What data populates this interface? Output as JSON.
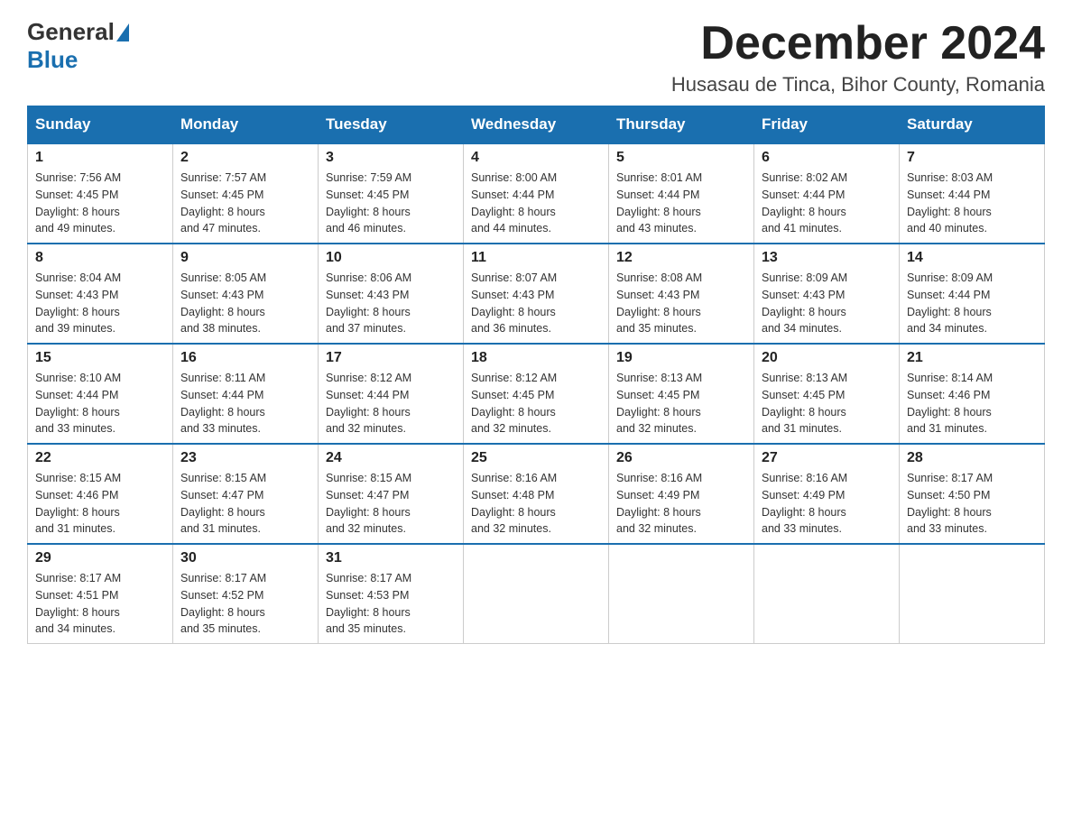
{
  "logo": {
    "general": "General",
    "blue": "Blue"
  },
  "header": {
    "month_title": "December 2024",
    "subtitle": "Husasau de Tinca, Bihor County, Romania"
  },
  "weekdays": [
    "Sunday",
    "Monday",
    "Tuesday",
    "Wednesday",
    "Thursday",
    "Friday",
    "Saturday"
  ],
  "weeks": [
    [
      {
        "day": "1",
        "info": "Sunrise: 7:56 AM\nSunset: 4:45 PM\nDaylight: 8 hours\nand 49 minutes."
      },
      {
        "day": "2",
        "info": "Sunrise: 7:57 AM\nSunset: 4:45 PM\nDaylight: 8 hours\nand 47 minutes."
      },
      {
        "day": "3",
        "info": "Sunrise: 7:59 AM\nSunset: 4:45 PM\nDaylight: 8 hours\nand 46 minutes."
      },
      {
        "day": "4",
        "info": "Sunrise: 8:00 AM\nSunset: 4:44 PM\nDaylight: 8 hours\nand 44 minutes."
      },
      {
        "day": "5",
        "info": "Sunrise: 8:01 AM\nSunset: 4:44 PM\nDaylight: 8 hours\nand 43 minutes."
      },
      {
        "day": "6",
        "info": "Sunrise: 8:02 AM\nSunset: 4:44 PM\nDaylight: 8 hours\nand 41 minutes."
      },
      {
        "day": "7",
        "info": "Sunrise: 8:03 AM\nSunset: 4:44 PM\nDaylight: 8 hours\nand 40 minutes."
      }
    ],
    [
      {
        "day": "8",
        "info": "Sunrise: 8:04 AM\nSunset: 4:43 PM\nDaylight: 8 hours\nand 39 minutes."
      },
      {
        "day": "9",
        "info": "Sunrise: 8:05 AM\nSunset: 4:43 PM\nDaylight: 8 hours\nand 38 minutes."
      },
      {
        "day": "10",
        "info": "Sunrise: 8:06 AM\nSunset: 4:43 PM\nDaylight: 8 hours\nand 37 minutes."
      },
      {
        "day": "11",
        "info": "Sunrise: 8:07 AM\nSunset: 4:43 PM\nDaylight: 8 hours\nand 36 minutes."
      },
      {
        "day": "12",
        "info": "Sunrise: 8:08 AM\nSunset: 4:43 PM\nDaylight: 8 hours\nand 35 minutes."
      },
      {
        "day": "13",
        "info": "Sunrise: 8:09 AM\nSunset: 4:43 PM\nDaylight: 8 hours\nand 34 minutes."
      },
      {
        "day": "14",
        "info": "Sunrise: 8:09 AM\nSunset: 4:44 PM\nDaylight: 8 hours\nand 34 minutes."
      }
    ],
    [
      {
        "day": "15",
        "info": "Sunrise: 8:10 AM\nSunset: 4:44 PM\nDaylight: 8 hours\nand 33 minutes."
      },
      {
        "day": "16",
        "info": "Sunrise: 8:11 AM\nSunset: 4:44 PM\nDaylight: 8 hours\nand 33 minutes."
      },
      {
        "day": "17",
        "info": "Sunrise: 8:12 AM\nSunset: 4:44 PM\nDaylight: 8 hours\nand 32 minutes."
      },
      {
        "day": "18",
        "info": "Sunrise: 8:12 AM\nSunset: 4:45 PM\nDaylight: 8 hours\nand 32 minutes."
      },
      {
        "day": "19",
        "info": "Sunrise: 8:13 AM\nSunset: 4:45 PM\nDaylight: 8 hours\nand 32 minutes."
      },
      {
        "day": "20",
        "info": "Sunrise: 8:13 AM\nSunset: 4:45 PM\nDaylight: 8 hours\nand 31 minutes."
      },
      {
        "day": "21",
        "info": "Sunrise: 8:14 AM\nSunset: 4:46 PM\nDaylight: 8 hours\nand 31 minutes."
      }
    ],
    [
      {
        "day": "22",
        "info": "Sunrise: 8:15 AM\nSunset: 4:46 PM\nDaylight: 8 hours\nand 31 minutes."
      },
      {
        "day": "23",
        "info": "Sunrise: 8:15 AM\nSunset: 4:47 PM\nDaylight: 8 hours\nand 31 minutes."
      },
      {
        "day": "24",
        "info": "Sunrise: 8:15 AM\nSunset: 4:47 PM\nDaylight: 8 hours\nand 32 minutes."
      },
      {
        "day": "25",
        "info": "Sunrise: 8:16 AM\nSunset: 4:48 PM\nDaylight: 8 hours\nand 32 minutes."
      },
      {
        "day": "26",
        "info": "Sunrise: 8:16 AM\nSunset: 4:49 PM\nDaylight: 8 hours\nand 32 minutes."
      },
      {
        "day": "27",
        "info": "Sunrise: 8:16 AM\nSunset: 4:49 PM\nDaylight: 8 hours\nand 33 minutes."
      },
      {
        "day": "28",
        "info": "Sunrise: 8:17 AM\nSunset: 4:50 PM\nDaylight: 8 hours\nand 33 minutes."
      }
    ],
    [
      {
        "day": "29",
        "info": "Sunrise: 8:17 AM\nSunset: 4:51 PM\nDaylight: 8 hours\nand 34 minutes."
      },
      {
        "day": "30",
        "info": "Sunrise: 8:17 AM\nSunset: 4:52 PM\nDaylight: 8 hours\nand 35 minutes."
      },
      {
        "day": "31",
        "info": "Sunrise: 8:17 AM\nSunset: 4:53 PM\nDaylight: 8 hours\nand 35 minutes."
      },
      null,
      null,
      null,
      null
    ]
  ]
}
